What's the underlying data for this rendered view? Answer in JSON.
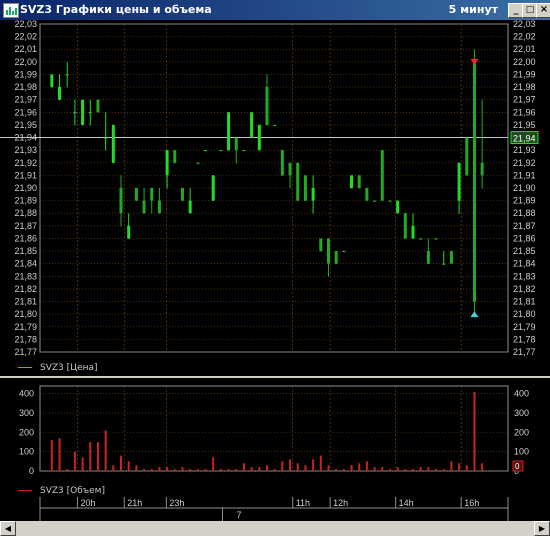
{
  "window": {
    "title": "SVZ3 Графики цены и объема",
    "timeframe": "5 минут",
    "btn_min": "_",
    "btn_max": "□",
    "btn_close": "×"
  },
  "colors": {
    "price_up": "#22dd22",
    "price_down": "#22aa22",
    "volume": "#cc2222",
    "grid": "#7a4a10",
    "axis_text": "#d0d0d0",
    "marker_top": "#ff2020",
    "marker_bottom": "#40d0e0"
  },
  "price_axis": {
    "min": 21.77,
    "max": 22.03,
    "ticks": [
      "22,03",
      "22,02",
      "22,01",
      "22,00",
      "21,99",
      "21,98",
      "21,97",
      "21,96",
      "21,95",
      "21,94",
      "21,93",
      "21,92",
      "21,91",
      "21,90",
      "21,89",
      "21,88",
      "21,87",
      "21,86",
      "21,85",
      "21,84",
      "21,83",
      "21,82",
      "21,81",
      "21,80",
      "21,79",
      "21,78",
      "21,77"
    ],
    "current_value": "21,94",
    "current": 21.94
  },
  "volume_axis": {
    "max": 440,
    "ticks": [
      "400",
      "300",
      "200",
      "100",
      "0"
    ],
    "current_value": "0"
  },
  "legend": {
    "price": "SVZ3 [Цена]",
    "volume": "SVZ3 [Объем]"
  },
  "time_axis": {
    "labels": [
      {
        "text": "20h",
        "x": 8
      },
      {
        "text": "21h",
        "x": 18
      },
      {
        "text": "23h",
        "x": 27
      },
      {
        "text": "11h",
        "x": 54
      },
      {
        "text": "12h",
        "x": 62
      },
      {
        "text": "14h",
        "x": 76
      },
      {
        "text": "16h",
        "x": 90
      }
    ],
    "date_label": "7",
    "date_x": 42,
    "date_line_x": 39
  },
  "chart_data": {
    "type": "bar",
    "series": [
      {
        "name": "SVZ3 [Цена]",
        "ohlc": [
          [
            21.98,
            21.99,
            21.98,
            21.99
          ],
          [
            21.97,
            21.99,
            21.97,
            21.98
          ],
          [
            21.99,
            22.0,
            21.98,
            21.99
          ],
          [
            21.96,
            21.97,
            21.95,
            21.96
          ],
          [
            21.95,
            21.97,
            21.95,
            21.97
          ],
          [
            21.96,
            21.97,
            21.95,
            21.96
          ],
          [
            21.97,
            21.97,
            21.96,
            21.96
          ],
          [
            21.94,
            21.96,
            21.93,
            21.94
          ],
          [
            21.92,
            21.95,
            21.92,
            21.95
          ],
          [
            21.9,
            21.91,
            21.87,
            21.88
          ],
          [
            21.86,
            21.88,
            21.86,
            21.87
          ],
          [
            21.9,
            21.9,
            21.89,
            21.89
          ],
          [
            21.89,
            21.9,
            21.88,
            21.88
          ],
          [
            21.9,
            21.9,
            21.88,
            21.89
          ],
          [
            21.89,
            21.9,
            21.88,
            21.88
          ],
          [
            21.91,
            21.93,
            21.9,
            21.93
          ],
          [
            21.93,
            21.93,
            21.92,
            21.92
          ],
          [
            21.9,
            21.9,
            21.89,
            21.89
          ],
          [
            21.88,
            21.9,
            21.88,
            21.89
          ],
          [
            21.92,
            21.92,
            21.92,
            21.92
          ],
          [
            21.93,
            21.93,
            21.93,
            21.93
          ],
          [
            21.89,
            21.91,
            21.89,
            21.91
          ],
          [
            21.93,
            21.93,
            21.93,
            21.93
          ],
          [
            21.93,
            21.96,
            21.93,
            21.96
          ],
          [
            21.94,
            21.94,
            21.92,
            21.93
          ],
          [
            21.93,
            21.93,
            21.93,
            21.93
          ],
          [
            21.94,
            21.96,
            21.94,
            21.96
          ],
          [
            21.93,
            21.95,
            21.93,
            21.95
          ],
          [
            21.98,
            21.99,
            21.95,
            21.95
          ],
          [
            21.95,
            21.95,
            21.95,
            21.95
          ],
          [
            21.93,
            21.93,
            21.91,
            21.91
          ],
          [
            21.92,
            21.92,
            21.9,
            21.91
          ],
          [
            21.92,
            21.92,
            21.89,
            21.89
          ],
          [
            21.91,
            21.91,
            21.89,
            21.89
          ],
          [
            21.89,
            21.91,
            21.88,
            21.9
          ],
          [
            21.86,
            21.86,
            21.85,
            21.85
          ],
          [
            21.86,
            21.86,
            21.83,
            21.84
          ],
          [
            21.85,
            21.85,
            21.84,
            21.84
          ],
          [
            21.85,
            21.85,
            21.85,
            21.85
          ],
          [
            21.9,
            21.91,
            21.9,
            21.91
          ],
          [
            21.91,
            21.91,
            21.9,
            21.9
          ],
          [
            21.9,
            21.9,
            21.89,
            21.89
          ],
          [
            21.89,
            21.89,
            21.89,
            21.89
          ],
          [
            21.93,
            21.93,
            21.89,
            21.89
          ],
          [
            21.89,
            21.89,
            21.89,
            21.89
          ],
          [
            21.88,
            21.89,
            21.88,
            21.89
          ],
          [
            21.88,
            21.88,
            21.86,
            21.86
          ],
          [
            21.86,
            21.88,
            21.86,
            21.87
          ],
          [
            21.86,
            21.86,
            21.86,
            21.86
          ],
          [
            21.85,
            21.86,
            21.84,
            21.84
          ],
          [
            21.86,
            21.86,
            21.86,
            21.86
          ],
          [
            21.84,
            21.85,
            21.84,
            21.84
          ],
          [
            21.85,
            21.85,
            21.84,
            21.84
          ],
          [
            21.89,
            21.92,
            21.88,
            21.92
          ],
          [
            21.94,
            21.94,
            21.91,
            21.91
          ],
          [
            22.0,
            22.01,
            21.8,
            21.81
          ],
          [
            21.92,
            21.97,
            21.9,
            21.91
          ]
        ]
      },
      {
        "name": "SVZ3 [Объем]",
        "values": [
          160,
          170,
          10,
          100,
          70,
          150,
          150,
          210,
          30,
          80,
          50,
          30,
          10,
          10,
          20,
          20,
          10,
          20,
          10,
          10,
          10,
          70,
          10,
          10,
          10,
          40,
          20,
          20,
          30,
          10,
          50,
          60,
          40,
          30,
          60,
          80,
          30,
          10,
          10,
          30,
          40,
          50,
          20,
          20,
          10,
          20,
          10,
          10,
          20,
          20,
          10,
          10,
          50,
          40,
          30,
          410,
          40
        ]
      }
    ],
    "price_ylim": [
      21.77,
      22.03
    ],
    "volume_ylim": [
      0,
      440
    ],
    "grid": true,
    "markers": [
      {
        "type": "sell-marker",
        "price": 22.0
      },
      {
        "type": "buy-marker",
        "price": 21.8
      }
    ]
  }
}
